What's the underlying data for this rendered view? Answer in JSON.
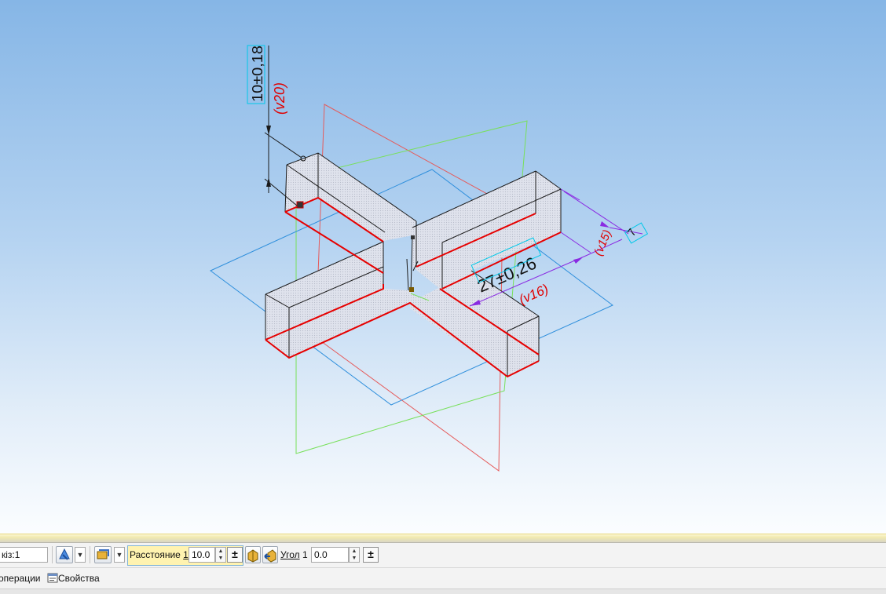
{
  "viewport": {
    "dimensions": {
      "vertical_value": "10±0,18",
      "vertical_var": "(v20)",
      "width_value": "27±0,26",
      "width_var": "(v16)",
      "small_var": "(v15)",
      "small_value": "7"
    }
  },
  "toolbar": {
    "sketch_field_value": "кiз:1",
    "distance_label": "Расстояние",
    "distance_index": "1",
    "distance_value": "10.0",
    "angle_label": "Угол",
    "angle_index": "1",
    "angle_value": "0.0",
    "plusminus": "±"
  },
  "tabs": {
    "operations_label": "операции",
    "properties_label": "Свойства"
  },
  "colors": {
    "plane_red": "#e55b5b",
    "plane_green": "#78e05a",
    "plane_blue": "#2f8fdc",
    "edge_red": "#e60000",
    "edge_black": "#1a1a1a",
    "dim_purple": "#8a2be2",
    "dim_red": "#e00000",
    "dim_cyan": "#00c8e8"
  },
  "icons": [
    "view-orient-icon",
    "sketch-icon",
    "extrude-direction-icon",
    "reverse-direction-icon",
    "properties-icon"
  ]
}
